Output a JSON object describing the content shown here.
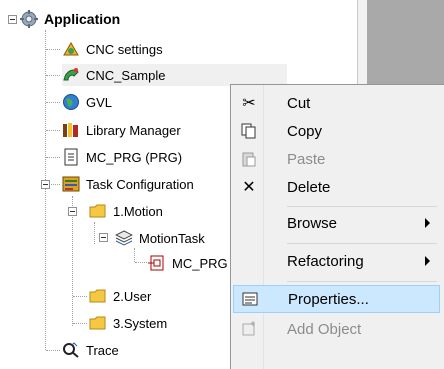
{
  "tree": {
    "root": {
      "label": "Application",
      "icon": "application-gear-icon"
    },
    "items": [
      {
        "label": "CNC settings",
        "icon": "cnc-settings-icon"
      },
      {
        "label": "CNC_Sample",
        "icon": "cnc-sample-icon"
      },
      {
        "label": "GVL",
        "icon": "globe-icon"
      },
      {
        "label": "Library Manager",
        "icon": "library-books-icon"
      },
      {
        "label": "MC_PRG (PRG)",
        "icon": "document-icon"
      },
      {
        "label": "Task Configuration",
        "icon": "task-config-icon"
      },
      {
        "label": "1.Motion",
        "icon": "folder-icon"
      },
      {
        "label": "MotionTask",
        "icon": "task-stack-icon"
      },
      {
        "label": "MC_PRG",
        "icon": "program-call-icon"
      },
      {
        "label": "2.User",
        "icon": "folder-icon"
      },
      {
        "label": "3.System",
        "icon": "folder-icon"
      },
      {
        "label": "Trace",
        "icon": "trace-icon"
      }
    ]
  },
  "context_menu": {
    "items": [
      {
        "label": "Cut",
        "icon": "scissors-icon"
      },
      {
        "label": "Copy",
        "icon": "copy-icon"
      },
      {
        "label": "Paste",
        "icon": "paste-icon",
        "disabled": true
      },
      {
        "label": "Delete",
        "icon": "delete-x-icon"
      },
      {
        "label": "Browse",
        "submenu": true
      },
      {
        "label": "Refactoring",
        "submenu": true
      },
      {
        "label": "Properties...",
        "icon": "properties-icon",
        "highlighted": true
      },
      {
        "label": "Add Object",
        "icon": "add-object-icon",
        "disabled": true
      }
    ]
  },
  "colors": {
    "menu_highlight": "#cce8ff",
    "folder": "#f5c842",
    "right_panel": "#a9a9a9"
  }
}
